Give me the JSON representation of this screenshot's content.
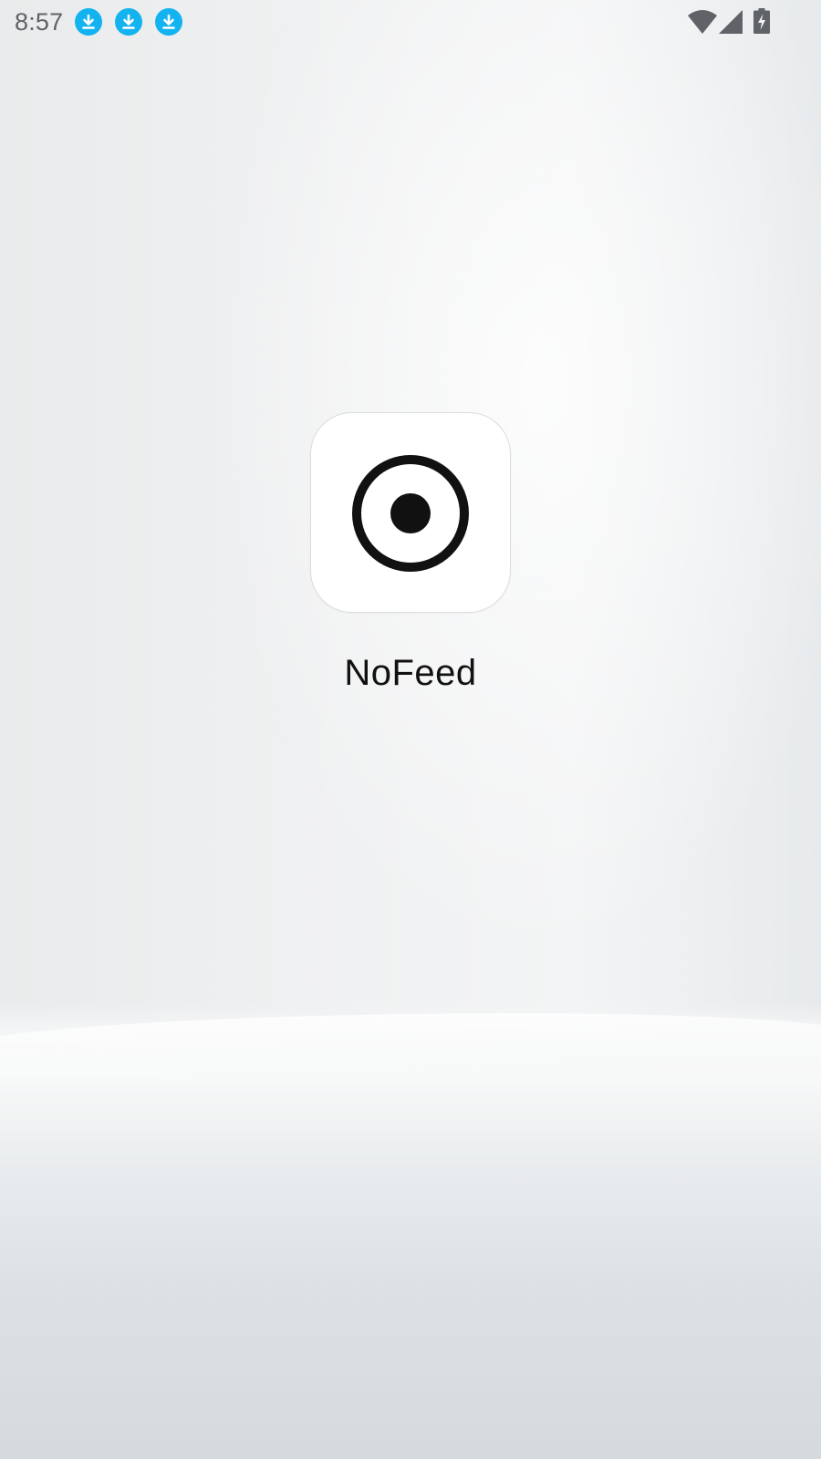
{
  "status_bar": {
    "time": "8:57",
    "notifications": [
      {
        "icon": "download-icon",
        "color": "#12b3ef"
      },
      {
        "icon": "download-icon",
        "color": "#12b3ef"
      },
      {
        "icon": "download-icon",
        "color": "#12b3ef"
      }
    ],
    "system_icons": [
      "wifi-icon",
      "cellular-signal-icon",
      "battery-charging-icon"
    ]
  },
  "home": {
    "apps": [
      {
        "label": "NoFeed",
        "icon": "target-circle-icon"
      }
    ]
  },
  "colors": {
    "status_text": "#5f6368",
    "notification_accent": "#12b3ef",
    "app_label": "#111111",
    "icon_background": "#ffffff"
  }
}
